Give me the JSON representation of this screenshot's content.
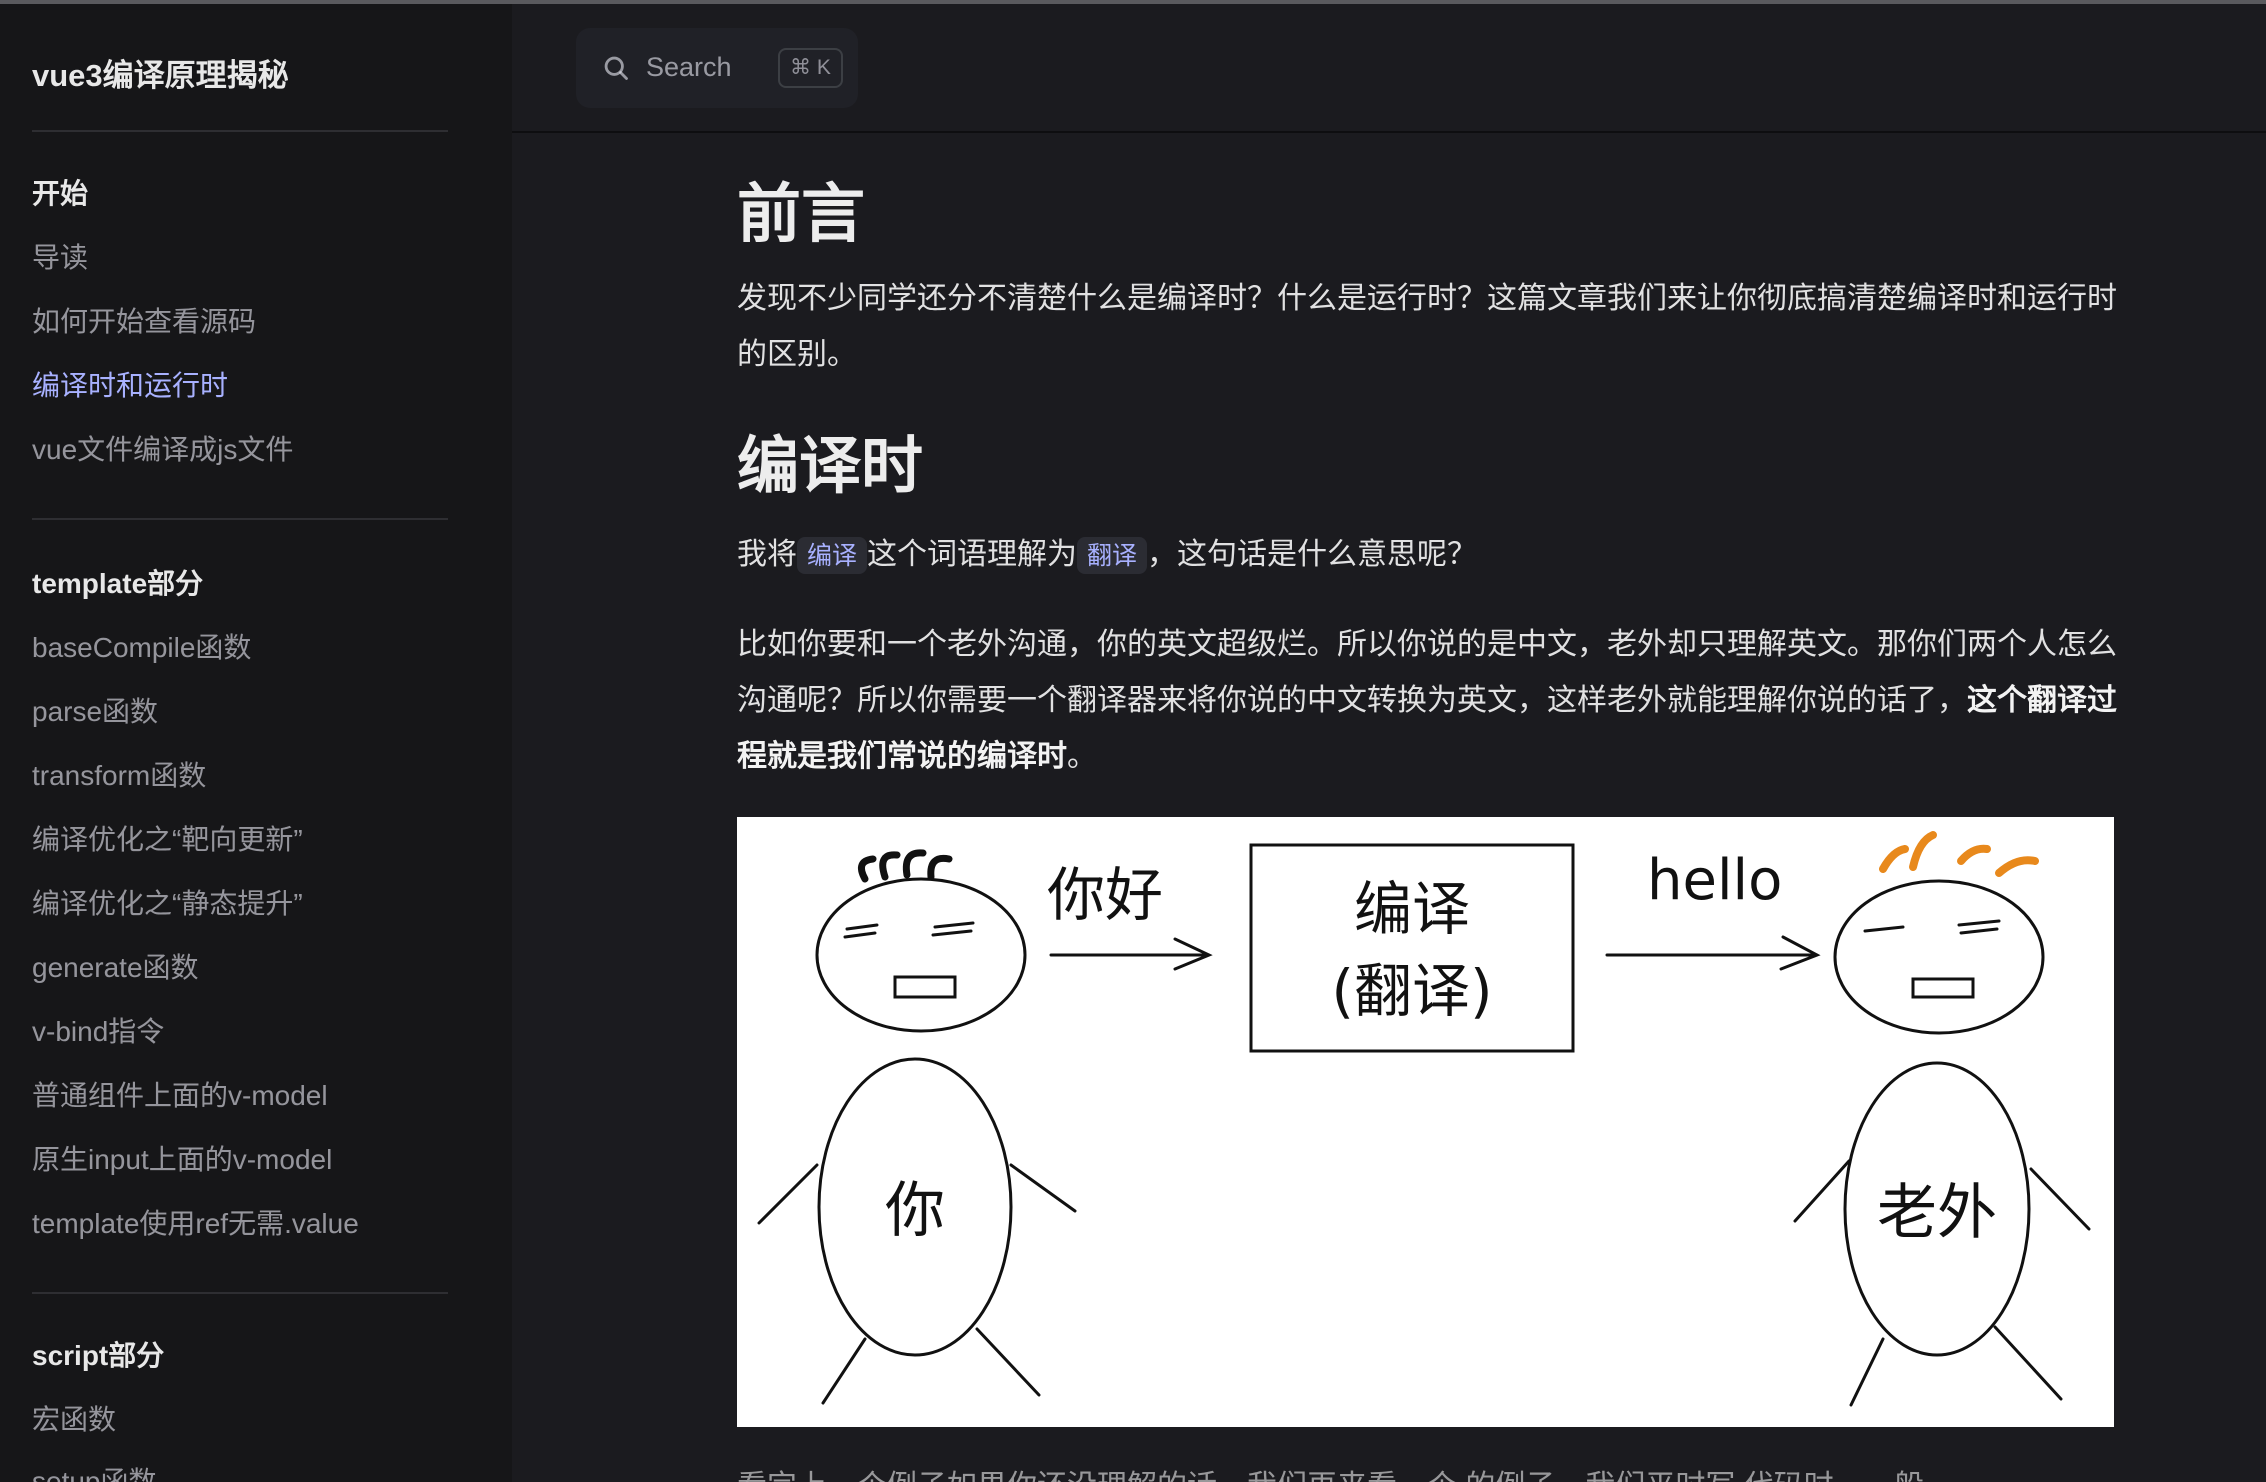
{
  "sidebar": {
    "site_title": "vue3编译原理揭秘",
    "groups": [
      {
        "title": "开始",
        "items": [
          "导读",
          "如何开始查看源码",
          "编译时和运行时",
          "vue文件编译成js文件"
        ]
      },
      {
        "title": "template部分",
        "items": [
          "baseCompile函数",
          "parse函数",
          "transform函数",
          "编译优化之“靶向更新”",
          "编译优化之“静态提升”",
          "generate函数",
          "v-bind指令",
          "普通组件上面的v-model",
          "原生input上面的v-model",
          "template使用ref无需.value"
        ]
      },
      {
        "title": "script部分",
        "items": [
          "宏函数",
          "setup函数"
        ]
      }
    ],
    "active_item": "编译时和运行时"
  },
  "navbar": {
    "search_placeholder": "Search",
    "search_shortcut": "⌘ K"
  },
  "article": {
    "h1": "前言",
    "intro": "发现不少同学还分不清楚什么是编译时？什么是运行时？这篇文章我们来让你彻底搞清楚编译时和运行时的区别。",
    "h2": "编译时",
    "p1_before": "我将",
    "p1_code1": "编译",
    "p1_middle": "这个词语理解为",
    "p1_code2": "翻译",
    "p1_after": "，这句话是什么意思呢？",
    "p2_text": "比如你要和一个老外沟通，你的英文超级烂。所以你说的是中文，老外却只理解英文。那你们两个人怎么沟通呢？所以你需要一个翻译器来将你说的中文转换为英文，这样老外就能理解你说的话了，",
    "p2_strong": "这个翻译过程就是我们常说的编译时",
    "p2_end": "。",
    "figure": {
      "left_bubble": "你好",
      "box_line1": "编译",
      "box_line2": "(翻译)",
      "right_bubble": "hello",
      "left_person": "你",
      "right_person": "老外"
    },
    "next_paragraph_partial": "看完上一个例子如果你还没理解的话，我们再来看一个      的例子，我们平时写      代码时，一般"
  },
  "colors": {
    "accent": "#a8b1ff",
    "background": "#1b1b1f",
    "sidebar_bg": "#161618",
    "hair_orange": "#e8891c"
  }
}
